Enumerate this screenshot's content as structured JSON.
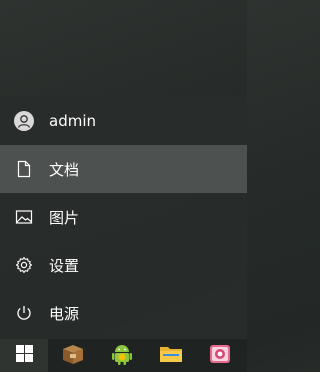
{
  "start_menu": {
    "items": [
      {
        "label": "admin",
        "icon": "user-avatar-icon"
      },
      {
        "label": "文档",
        "icon": "document-icon"
      },
      {
        "label": "图片",
        "icon": "pictures-icon"
      },
      {
        "label": "设置",
        "icon": "gear-icon"
      },
      {
        "label": "电源",
        "icon": "power-icon"
      }
    ],
    "active_index": 1
  },
  "taskbar": {
    "start_icon": "windows-logo-icon",
    "apps": [
      {
        "icon": "box-app-icon"
      },
      {
        "icon": "android-app-icon"
      },
      {
        "icon": "folder-icon"
      },
      {
        "icon": "photo-viewer-icon"
      }
    ]
  },
  "colors": {
    "active_item_bg": "#4d514f",
    "menu_bg": "#2a2e2c",
    "taskbar_bg": "#1f2422",
    "text": "#ffffff"
  }
}
